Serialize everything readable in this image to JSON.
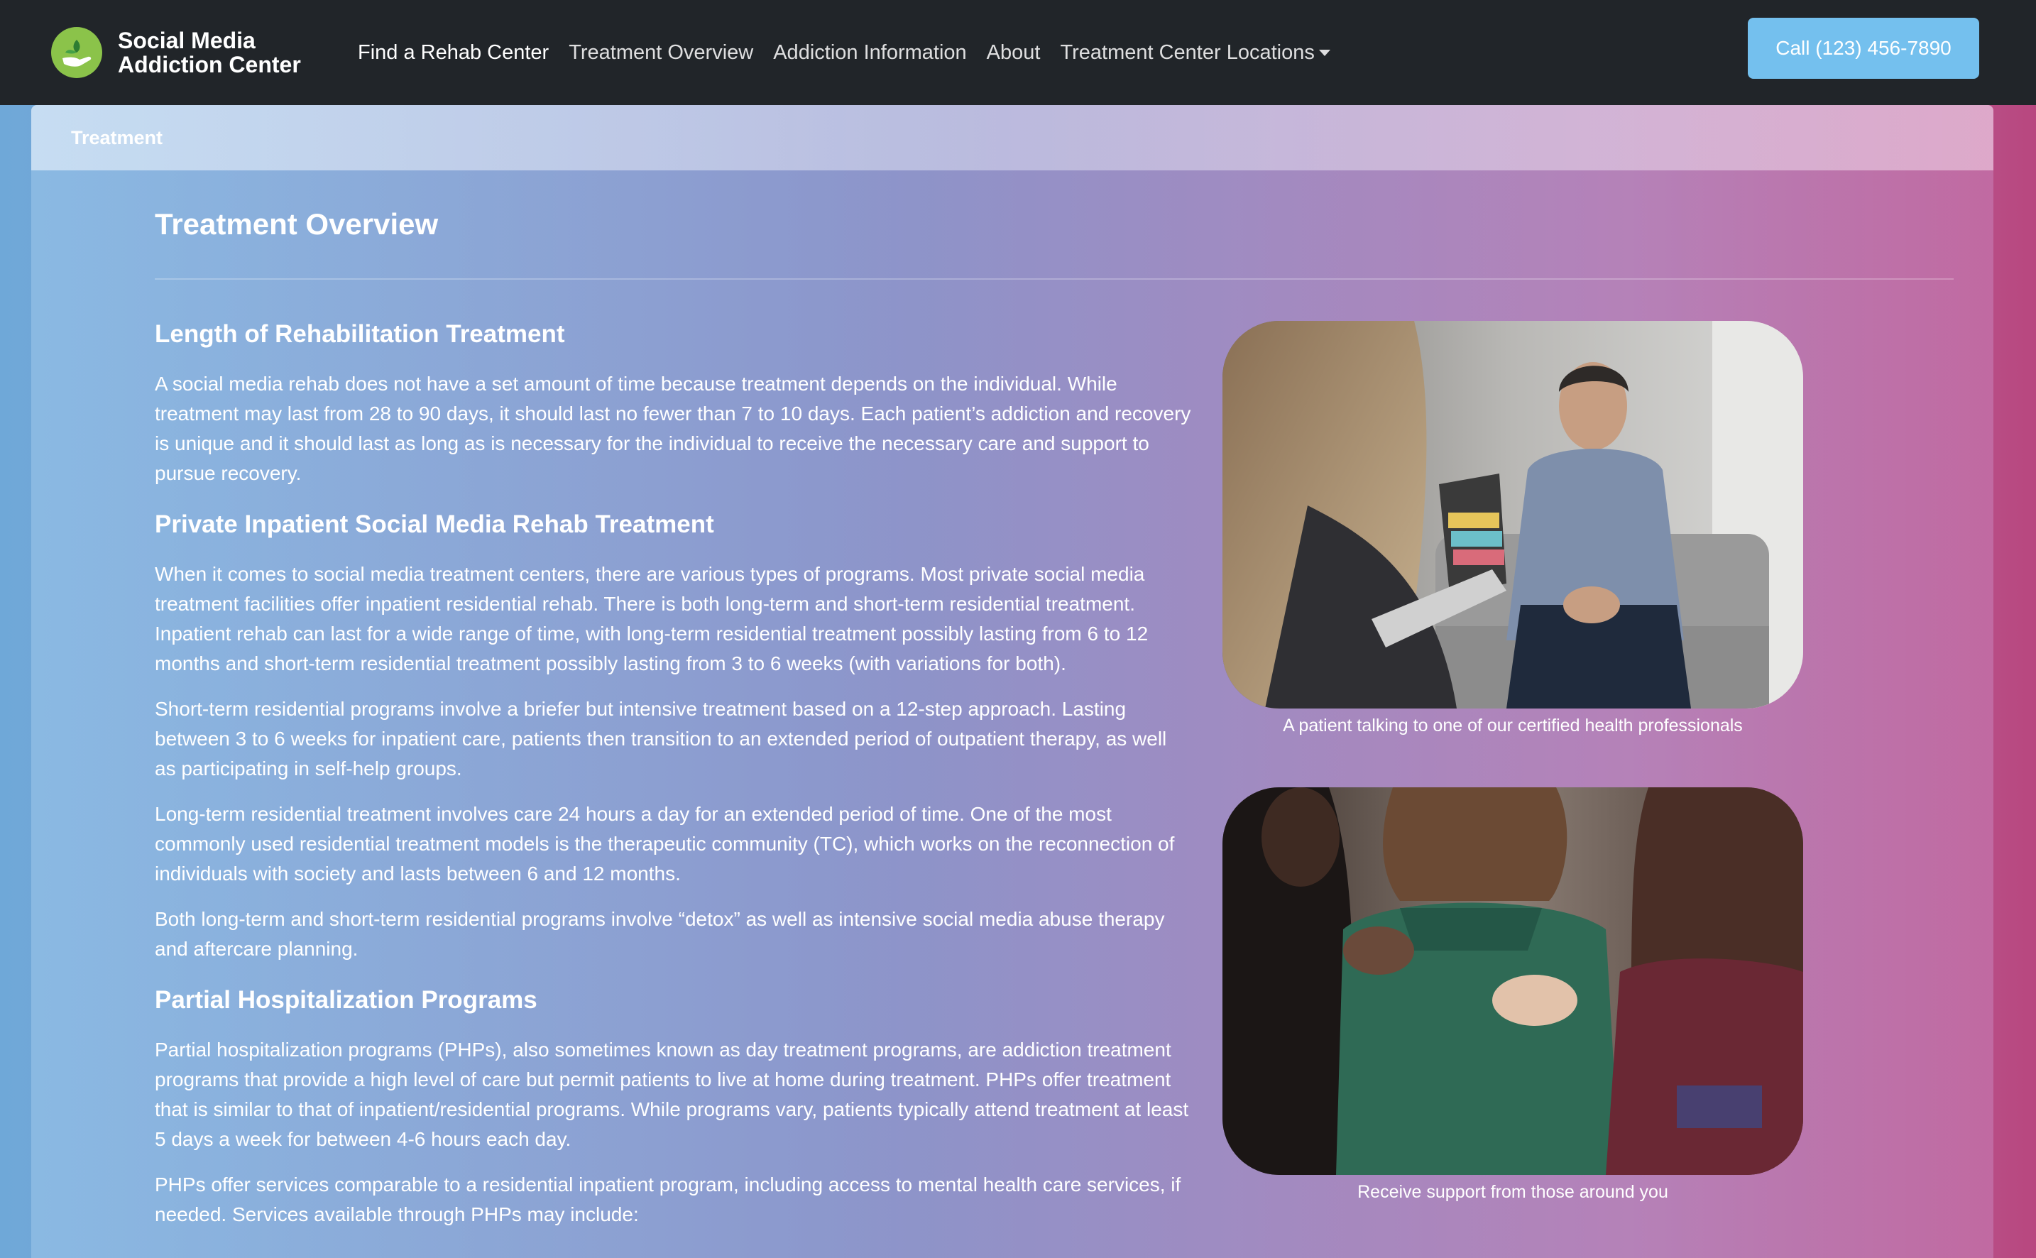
{
  "navbar": {
    "brand": "Social Media Addiction Center",
    "links": [
      {
        "label": "Find a Rehab Center"
      },
      {
        "label": "Treatment Overview"
      },
      {
        "label": "Addiction Information"
      },
      {
        "label": "About"
      },
      {
        "label": "Treatment Center Locations"
      }
    ],
    "call_label": "Call (123) 456-7890"
  },
  "card": {
    "header": "Treatment",
    "title": "Treatment Overview",
    "sections": {
      "length": {
        "heading": "Length of Rehabilitation Treatment",
        "p1": "A social media rehab does not have a set amount of time because treatment depends on the individual. While treatment may last from 28 to 90 days, it should last no fewer than 7 to 10 days. Each patient’s addiction and recovery is unique and it should last as long as is necessary for the individual to receive the necessary care and support to pursue recovery."
      },
      "inpatient": {
        "heading": "Private Inpatient Social Media Rehab Treatment",
        "p1": "When it comes to social media treatment centers, there are various types of programs. Most private social media treatment facilities offer inpatient residential rehab. There is both long-term and short-term residential treatment. Inpatient rehab can last for a wide range of time, with long-term residential treatment possibly lasting from 6 to 12 months and short-term residential treatment possibly lasting from 3 to 6 weeks (with variations for both).",
        "p2": "Short-term residential programs involve a briefer but intensive treatment based on a 12-step approach. Lasting between 3 to 6 weeks for inpatient care, patients then transition to an extended period of outpatient therapy, as well as participating in self-help groups.",
        "p3": "Long-term residential treatment involves care 24 hours a day for an extended period of time. One of the most commonly used residential treatment models is the therapeutic community (TC), which works on the reconnection of individuals with society and lasts between 6 and 12 months.",
        "p4": "Both long-term and short-term residential programs involve “detox” as well as intensive social media abuse therapy and aftercare planning."
      },
      "php": {
        "heading": "Partial Hospitalization Programs",
        "p1": "Partial hospitalization programs (PHPs), also sometimes known as day treatment programs, are addiction treatment programs that provide a high level of care but permit patients to live at home during treatment. PHPs offer treatment that is similar to that of inpatient/residential programs. While programs vary, patients typically attend treatment at least 5 days a week for between 4-6 hours each day.",
        "p2": "PHPs offer services comparable to a residential inpatient program, including access to mental health care services, if needed. Services available through PHPs may include:"
      }
    },
    "images": [
      {
        "caption": "A patient talking to one of our certified health professionals"
      },
      {
        "caption": "Receive support from those around you"
      }
    ]
  }
}
